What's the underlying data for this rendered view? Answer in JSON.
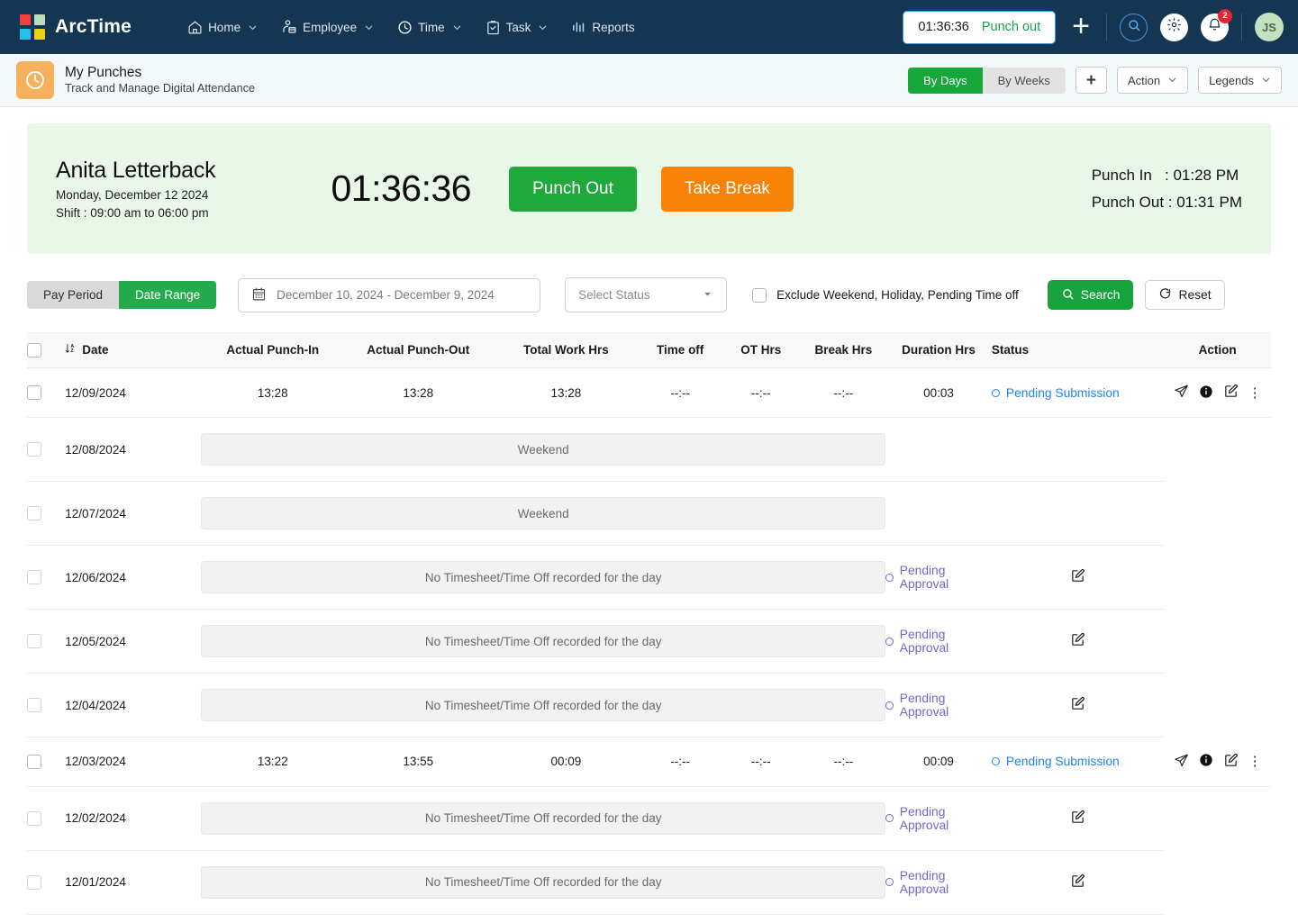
{
  "app": {
    "brand": "ArcTime",
    "nav": [
      {
        "label": "Home",
        "icon": "home-icon",
        "caret": true
      },
      {
        "label": "Employee",
        "icon": "employee-icon",
        "caret": true
      },
      {
        "label": "Time",
        "icon": "clock-icon",
        "caret": true
      },
      {
        "label": "Task",
        "icon": "clipboard-check-icon",
        "caret": true
      },
      {
        "label": "Reports",
        "icon": "bar-chart-icon",
        "caret": false
      }
    ],
    "timer_pill": {
      "value": "01:36:36",
      "label": "Punch out"
    },
    "notifications_count": "2",
    "avatar_initials": "JS",
    "accent_dark": "#143653",
    "accent_green": "#17a83c"
  },
  "subheader": {
    "title": "My Punches",
    "subtitle": "Track and Manage Digital Attendance",
    "view_toggle": {
      "options": [
        "By Days",
        "By Weeks"
      ],
      "selected": "By Days"
    },
    "add_label": "+",
    "action_label": "Action",
    "legends_label": "Legends"
  },
  "employee_card": {
    "name": "Anita Letterback",
    "date": "Monday, December 12 2024",
    "shift": "Shift : 09:00 am to 06:00 pm",
    "timer": "01:36:36",
    "punch_out_button": "Punch Out",
    "take_break_button": "Take Break",
    "punch_in_label": "Punch In",
    "punch_in_value": ": 01:28 PM",
    "punch_out_label": "Punch Out",
    "punch_out_value": ": 01:31 PM"
  },
  "filters": {
    "period_toggle": {
      "options": [
        "Pay Period",
        "Date Range"
      ],
      "selected": "Date Range"
    },
    "date_range": "December 10, 2024 - December 9, 2024",
    "status_placeholder": "Select Status",
    "exclude_label": "Exclude Weekend, Holiday, Pending Time off",
    "exclude_checked": false,
    "search_label": "Search",
    "reset_label": "Reset"
  },
  "table": {
    "columns": [
      "Date",
      "Actual Punch-In",
      "Actual Punch-Out",
      "Total Work Hrs",
      "Time off",
      "OT Hrs",
      "Break Hrs",
      "Duration Hrs",
      "Status",
      "Action"
    ],
    "rows": [
      {
        "kind": "data",
        "date": "12/09/2024",
        "punch_in": "13:28",
        "punch_out": "13:28",
        "total_work": "13:28",
        "time_off": "--:--",
        "ot": "--:--",
        "break": "--:--",
        "duration": "00:03",
        "status": "Pending Submission",
        "status_type": "submission",
        "actions": [
          "send-icon",
          "info-icon",
          "edit-icon",
          "more-icon"
        ]
      },
      {
        "kind": "span",
        "date": "12/08/2024",
        "message": "Weekend",
        "status": "",
        "status_type": "",
        "actions": []
      },
      {
        "kind": "span",
        "date": "12/07/2024",
        "message": "Weekend",
        "status": "",
        "status_type": "",
        "actions": []
      },
      {
        "kind": "span",
        "date": "12/06/2024",
        "message": "No Timesheet/Time Off recorded for the day",
        "status": "Pending Approval",
        "status_type": "approval",
        "actions": [
          "edit-icon"
        ]
      },
      {
        "kind": "span",
        "date": "12/05/2024",
        "message": "No Timesheet/Time Off recorded for the day",
        "status": "Pending Approval",
        "status_type": "approval",
        "actions": [
          "edit-icon"
        ]
      },
      {
        "kind": "span",
        "date": "12/04/2024",
        "message": "No Timesheet/Time Off recorded for the day",
        "status": "Pending Approval",
        "status_type": "approval",
        "actions": [
          "edit-icon"
        ]
      },
      {
        "kind": "data",
        "date": "12/03/2024",
        "punch_in": "13:22",
        "punch_out": "13:55",
        "total_work": "00:09",
        "time_off": "--:--",
        "ot": "--:--",
        "break": "--:--",
        "duration": "00:09",
        "status": "Pending Submission",
        "status_type": "submission",
        "actions": [
          "send-icon",
          "info-icon",
          "edit-icon",
          "more-icon"
        ]
      },
      {
        "kind": "span",
        "date": "12/02/2024",
        "message": "No Timesheet/Time Off recorded for the day",
        "status": "Pending Approval",
        "status_type": "approval",
        "actions": [
          "edit-icon"
        ]
      },
      {
        "kind": "span",
        "date": "12/01/2024",
        "message": "No Timesheet/Time Off recorded for the day",
        "status": "Pending Approval",
        "status_type": "approval",
        "actions": [
          "edit-icon"
        ]
      }
    ]
  }
}
